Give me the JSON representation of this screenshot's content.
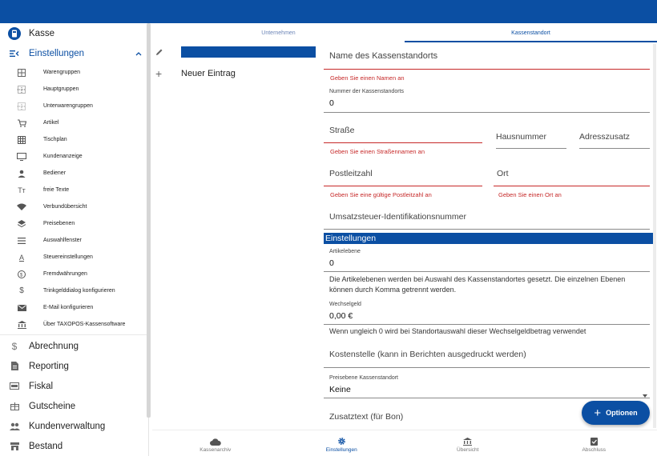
{
  "sidebar": {
    "top_item": {
      "label": "Kasse",
      "icon": "cash-register-icon"
    },
    "settings": {
      "label": "Einstellungen",
      "icon": "settings-menu-icon"
    },
    "sub_items": [
      {
        "label": "Warengruppen",
        "icon": "grid-icon"
      },
      {
        "label": "Hauptgruppen",
        "icon": "grid-dotted-icon"
      },
      {
        "label": "Unterwarengruppen",
        "icon": "grid-dotted-icon"
      },
      {
        "label": "Artikel",
        "icon": "cart-icon"
      },
      {
        "label": "Tischplan",
        "icon": "table-grid-icon"
      },
      {
        "label": "Kundenanzeige",
        "icon": "monitor-icon"
      },
      {
        "label": "Bediener",
        "icon": "person-icon"
      },
      {
        "label": "freie Texte",
        "icon": "text-icon"
      },
      {
        "label": "Verbundübersicht",
        "icon": "wifi-icon"
      },
      {
        "label": "Preisebenen",
        "icon": "layers-icon"
      },
      {
        "label": "Auswahlfenster",
        "icon": "menu-lines-icon"
      },
      {
        "label": "Steuereinstellungen",
        "icon": "underline-a-icon"
      },
      {
        "label": "Fremdwährungen",
        "icon": "currency-exchange-icon"
      },
      {
        "label": "Trinkgelddialog konfigurieren",
        "icon": "dollar-icon"
      },
      {
        "label": "E-Mail konfigurieren",
        "icon": "mail-icon"
      },
      {
        "label": "Über TAXOPOS-Kassensoftware",
        "icon": "bank-icon"
      }
    ],
    "main_items": [
      {
        "label": "Abrechnung",
        "icon": "dollar-icon"
      },
      {
        "label": "Reporting",
        "icon": "document-icon"
      },
      {
        "label": "Fiskal",
        "icon": "fiscal-icon"
      },
      {
        "label": "Gutscheine",
        "icon": "gift-icon"
      },
      {
        "label": "Kundenverwaltung",
        "icon": "people-icon"
      },
      {
        "label": "Bestand",
        "icon": "store-icon"
      }
    ]
  },
  "tabs": [
    {
      "label": "Unternehmen"
    },
    {
      "label": "Kassenstandort"
    }
  ],
  "list": {
    "new_entry": "Neuer Eintrag"
  },
  "form": {
    "name_label": "Name des Kassenstandorts",
    "name_error": "Geben Sie einen Namen an",
    "number_label": "Nummer der Kassenstandorts",
    "number_value": "0",
    "street_label": "Straße",
    "street_error": "Geben Sie einen Straßennamen an",
    "house_label": "Hausnummer",
    "address_extra_label": "Adresszusatz",
    "zip_label": "Postleitzahl",
    "zip_error": "Geben Sie eine gültige Postleitzahl an",
    "city_label": "Ort",
    "city_error": "Geben Sie einen Ort an",
    "vat_label": "Umsatzsteuer-Identifikationsnummer",
    "section_title": "Einstellungen",
    "article_level_label": "Artikelebene",
    "article_level_value": "0",
    "article_level_help": "Die Artikelebenen werden bei Auswahl des Kassenstandortes gesetzt. Die einzelnen Ebenen können durch Komma getrennt werden.",
    "change_money_label": "Wechselgeld",
    "change_money_value": "0,00 €",
    "change_money_help": "Wenn ungleich 0 wird bei Standortauswahl dieser Wechselgeldbetrag verwendet",
    "cost_center_label": "Kostenstelle (kann in Berichten ausgedruckt werden)",
    "price_level_label": "Preisebene Kassenstandort",
    "price_level_value": "Keine",
    "extra_text_label": "Zusatztext (für Bon)"
  },
  "fab": {
    "label": "Optionen"
  },
  "bottom_nav": [
    {
      "label": "Kassenarchiv",
      "icon": "cloud-icon"
    },
    {
      "label": "Einstellungen",
      "icon": "gear-icon"
    },
    {
      "label": "Übersicht",
      "icon": "bank-icon"
    },
    {
      "label": "Abschluss",
      "icon": "clipboard-check-icon"
    }
  ],
  "colors": {
    "primary": "#0b4fa3",
    "error": "#c62828"
  }
}
